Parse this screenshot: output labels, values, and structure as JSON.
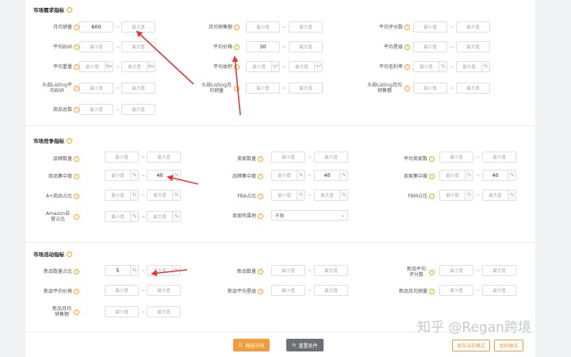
{
  "help_glyph": "?",
  "dash": "~",
  "sections": {
    "demand": "市场需求指标",
    "competition": "市场竞争指标",
    "activity": "市场活动指标"
  },
  "ph": {
    "min": "最小值",
    "max": "最大值"
  },
  "units": {
    "lbs": "lbs",
    "in3": "in³",
    "pct": "%"
  },
  "labels": {
    "avg_monthly_sales": "月均销量",
    "avg_monthly_revenue": "月均销售额",
    "avg_reviews": "平均评分数",
    "avg_bsr": "平均BSR",
    "avg_price": "平均价格",
    "avg_rating": "平均星级",
    "avg_weight": "平均重量",
    "avg_volume": "平均体积",
    "avg_margin": "平均毛利率",
    "top_listing_bsr": "头部Listing平均BSR",
    "top_listing_sales": "头部Listing月均销量",
    "top_listing_revenue": "头部Listing月均销售额",
    "product_count": "商品总数",
    "brand_count": "品牌数量",
    "seller_count": "卖家数量",
    "avg_seller_count": "平均卖家数",
    "product_concentration": "商品集中度",
    "brand_concentration": "品牌集中度",
    "seller_concentration": "卖家集中度",
    "aplus_ratio": "A+商品占比",
    "fba_ratio": "FBA占比",
    "fbm_ratio": "FBM占比",
    "amazon_ratio": "Amazon自营占比",
    "seller_location": "卖家所属地",
    "new_ratio": "新品数量占比",
    "new_count": "新品数量",
    "new_avg_reviews": "新品平均评分数",
    "new_avg_price": "新品平均价格",
    "new_avg_rating": "新品平均星级",
    "new_monthly_sales": "新品月均销量",
    "new_monthly_revenue": "新品月均销售额"
  },
  "values": {
    "avg_monthly_sales_min": "600",
    "avg_price_min": "30",
    "product_concentration_max": "40",
    "brand_concentration_max": "40",
    "seller_concentration_max": "40",
    "new_ratio_min": "5"
  },
  "seller_location_value": "不限",
  "buttons": {
    "filter": "筛选市场",
    "reset": "重置条件",
    "save_mode": "保存当前模式",
    "my_mode": "我的模式"
  },
  "watermark": "知乎 @Regan跨境",
  "colors": {
    "accent": "#f39c3c",
    "arrow": "#e53935"
  }
}
